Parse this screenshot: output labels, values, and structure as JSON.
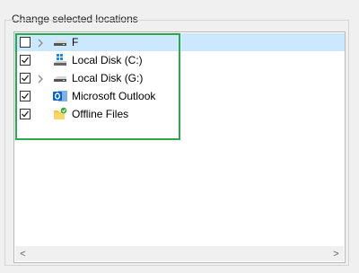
{
  "group": {
    "title": "Change selected locations"
  },
  "tree": {
    "items": [
      {
        "label": "F",
        "checked": false,
        "expander": true,
        "icon": "removable-drive-icon",
        "selected": true
      },
      {
        "label": "Local Disk (C:)",
        "checked": true,
        "expander": false,
        "icon": "windows-drive-icon",
        "selected": false
      },
      {
        "label": "Local Disk (G:)",
        "checked": true,
        "expander": true,
        "icon": "drive-icon",
        "selected": false
      },
      {
        "label": "Microsoft Outlook",
        "checked": true,
        "expander": false,
        "icon": "outlook-icon",
        "selected": false
      },
      {
        "label": "Offline Files",
        "checked": true,
        "expander": false,
        "icon": "offline-files-icon",
        "selected": false
      }
    ]
  },
  "scrollbar": {
    "left_arrow": "<",
    "right_arrow": ">"
  },
  "colors": {
    "selection": "#cce8ff",
    "highlight_box": "#2aa84a",
    "outlook": "#0a64c8"
  }
}
